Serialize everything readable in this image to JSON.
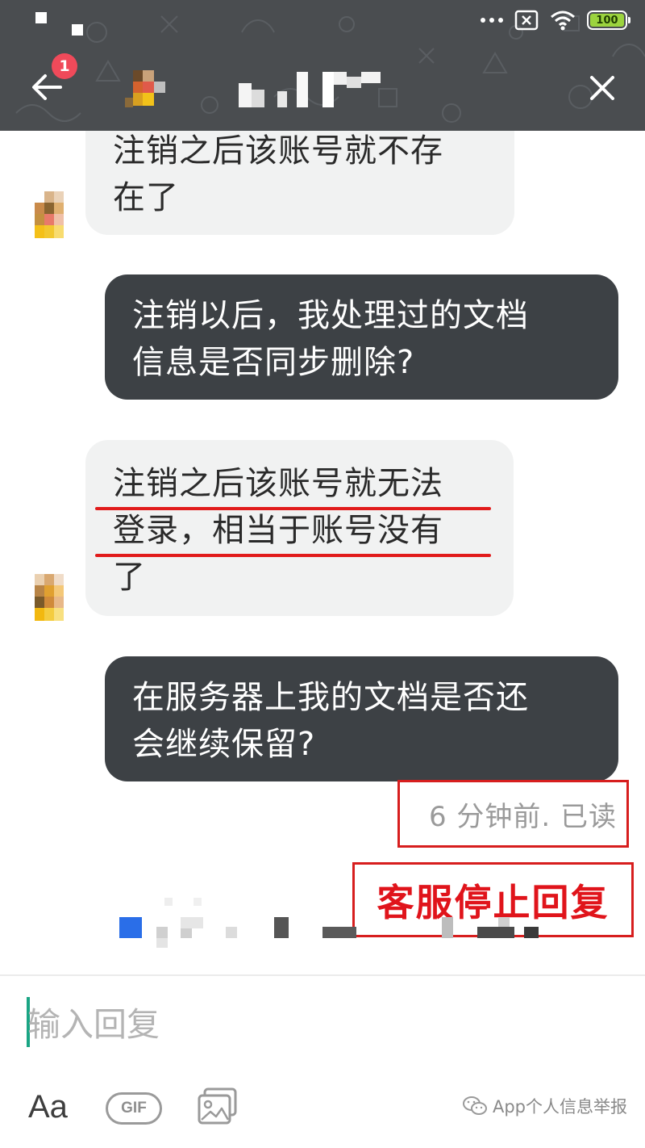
{
  "status_bar": {
    "battery_level": "100",
    "icons": [
      "more-dots-icon",
      "sim-x-icon",
      "wifi-icon",
      "battery-icon"
    ]
  },
  "header": {
    "unread_badge": "1",
    "back_icon": "arrow-left-icon",
    "close_icon": "close-icon",
    "background_color": "#4a4d50"
  },
  "messages": [
    {
      "direction": "incoming",
      "lines": [
        "注销之后该账号就不存",
        "在了"
      ]
    },
    {
      "direction": "outgoing",
      "lines": [
        "注销以后，我处理过的文档",
        "信息是否同步删除?"
      ]
    },
    {
      "direction": "incoming",
      "lines": [
        "注销之后该账号就无法",
        "登录，相当于账号没有",
        "了"
      ]
    },
    {
      "direction": "outgoing",
      "lines": [
        "在服务器上我的文档是否还",
        "会继续保留?"
      ]
    }
  ],
  "read_status": "6 分钟前. 已读",
  "annotation": "客服停止回复",
  "composer": {
    "placeholder": "输入回复",
    "aa_label": "Aa",
    "gif_label": "GIF",
    "image_icon": "image-icon"
  },
  "watermark": "App个人信息举报",
  "colors": {
    "outgoing_bubble": "#3d4145",
    "incoming_bubble": "#f1f2f2",
    "annotation_red": "#e0141b",
    "cursor_green": "#1aa584"
  }
}
